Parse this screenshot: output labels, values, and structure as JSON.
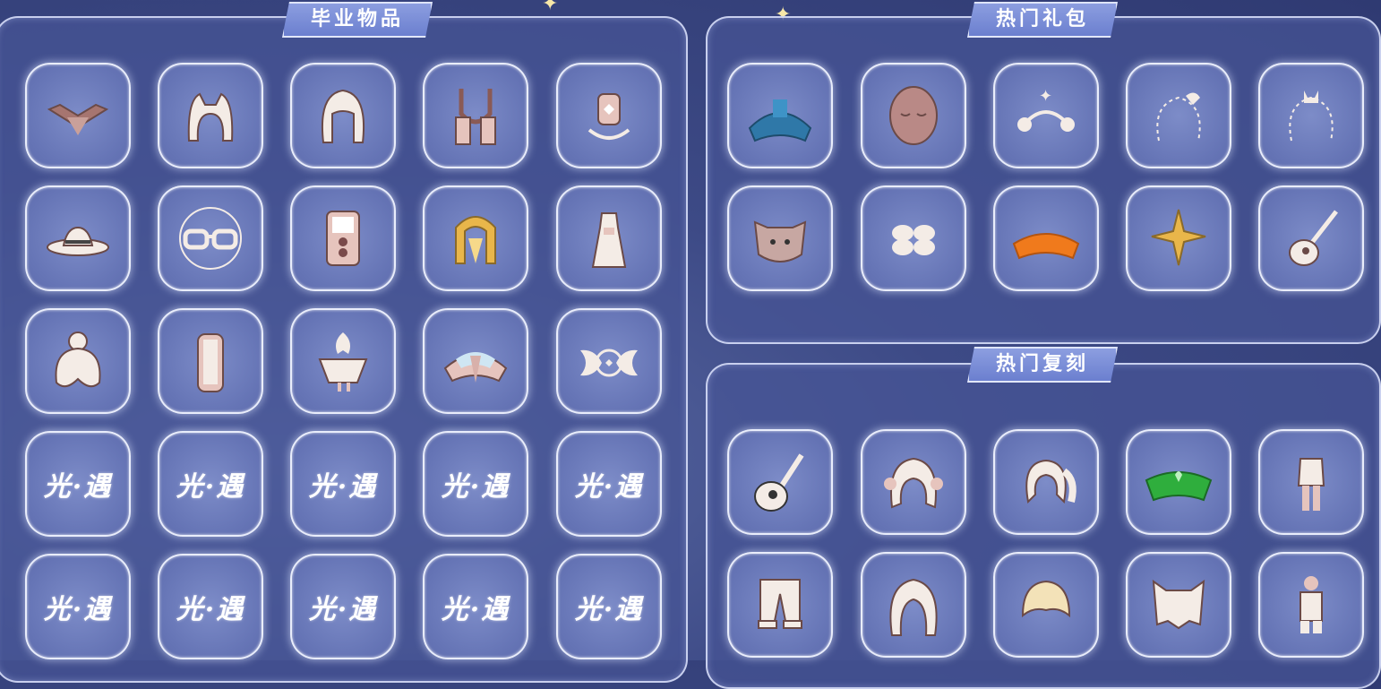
{
  "sections": {
    "graduation": {
      "title": "毕业物品"
    },
    "gift_packs": {
      "title": "热门礼包"
    },
    "reprints": {
      "title": "热门复刻"
    }
  },
  "watermark_logo": "光·遇",
  "graduation_items": [
    "bird-cape-icon",
    "cat-ear-hair-icon",
    "bob-hair-icon",
    "necklace-icon",
    "lantern-prop-icon",
    "cowboy-hat-icon",
    "glasses-icon",
    "phone-prop-icon",
    "golden-scarf-icon",
    "dress-outfit-icon",
    "bun-hair-icon",
    "scroll-cape-icon",
    "antler-mask-icon",
    "layered-cape-icon",
    "wing-mask-icon",
    "logo-placeholder-icon",
    "logo-placeholder-icon",
    "logo-placeholder-icon",
    "logo-placeholder-icon",
    "logo-placeholder-icon",
    "logo-placeholder-icon",
    "logo-placeholder-icon",
    "logo-placeholder-icon",
    "logo-placeholder-icon",
    "logo-placeholder-icon"
  ],
  "gift_items": [
    "blue-cape-icon",
    "face-mask-icon",
    "moon-star-headband-icon",
    "shell-hair-accessory-icon",
    "cat-hair-accessory-icon",
    "dog-mask-icon",
    "flower-accessory-icon",
    "orange-cape-icon",
    "golden-star-accessory-icon",
    "guitar-icon"
  ],
  "reprint_items": [
    "ukulele-icon",
    "twin-bun-hair-icon",
    "pigtail-hair-icon",
    "green-cape-icon",
    "outfit-icon",
    "pants-icon",
    "curly-hair-icon",
    "short-hair-icon",
    "cat-hood-hair-icon",
    "short-outfit-icon"
  ],
  "colors": {
    "panel": "#4f5c9c",
    "slot": "#6e7cbd",
    "title_bg": "#7b8ed8"
  }
}
